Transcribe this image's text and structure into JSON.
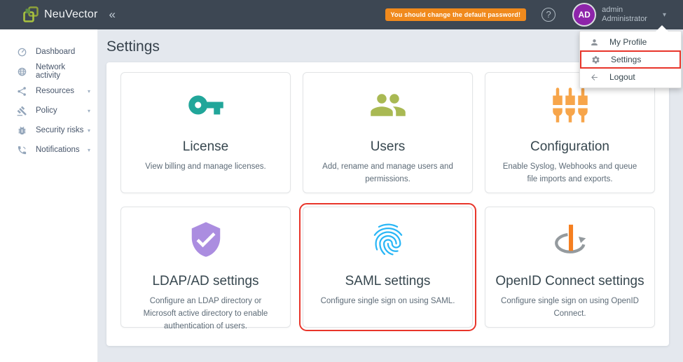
{
  "navbar": {
    "brand": "NeuVector",
    "collapse_glyph": "«",
    "password_warning": "You should change the default password!",
    "help_glyph": "?",
    "caret_glyph": "▾",
    "user": {
      "initials": "AD",
      "name": "admin",
      "role": "Administrator"
    }
  },
  "user_menu": {
    "items": [
      {
        "label": "My Profile"
      },
      {
        "label": "Settings",
        "highlighted": true
      },
      {
        "label": "Logout"
      }
    ]
  },
  "sidebar": {
    "caret_glyph": "▾",
    "items": [
      {
        "label": "Dashboard",
        "expandable": false
      },
      {
        "label": "Network activity",
        "expandable": false
      },
      {
        "label": "Resources",
        "expandable": true
      },
      {
        "label": "Policy",
        "expandable": true
      },
      {
        "label": "Security risks",
        "expandable": true
      },
      {
        "label": "Notifications",
        "expandable": true
      }
    ]
  },
  "main": {
    "title": "Settings",
    "cards": [
      {
        "title": "License",
        "description": "View billing and manage licenses.",
        "icon": "key-icon",
        "color": "#21a69a"
      },
      {
        "title": "Users",
        "description": "Add, rename and manage users and permissions.",
        "icon": "users-icon",
        "color": "#a9b953"
      },
      {
        "title": "Configuration",
        "description": "Enable Syslog, Webhooks and queue file imports and exports.",
        "icon": "sliders-icon",
        "color": "#f7a54a"
      },
      {
        "title": "LDAP/AD settings",
        "description": "Configure an LDAP directory or Microsoft active directory to enable authentication of users.",
        "icon": "shield-check-icon",
        "color": "#ab8de0"
      },
      {
        "title": "SAML settings",
        "description": "Configure single sign on using SAML.",
        "icon": "fingerprint-icon",
        "color": "#29b6f6",
        "highlighted": true
      },
      {
        "title": "OpenID Connect settings",
        "description": "Configure single sign on using OpenID Connect.",
        "icon": "openid-icon",
        "color": "#f57f20"
      }
    ]
  },
  "colors": {
    "navbar_bg": "#3d4753",
    "main_bg": "#e4e8ee",
    "badge_orange": "#f08a1d",
    "highlight_red": "#e8352a",
    "avatar_purple": "#8e24aa"
  }
}
